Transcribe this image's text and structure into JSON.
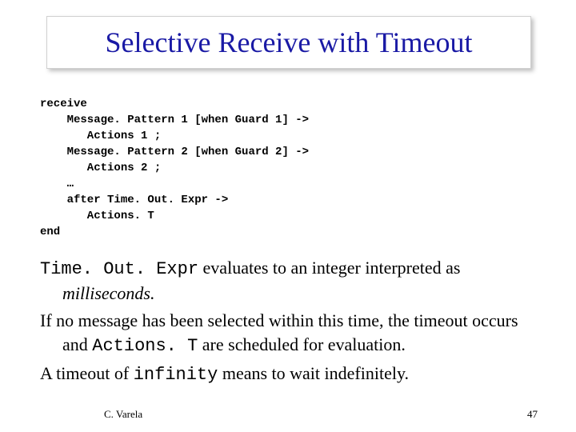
{
  "title": "Selective Receive with Timeout",
  "code": {
    "l1": "receive",
    "l2": "    Message. Pattern 1 [when Guard 1] ->",
    "l3": "       Actions 1 ;",
    "l4": "    Message. Pattern 2 [when Guard 2] ->",
    "l5": "       Actions 2 ;",
    "l6": "    …",
    "l7": "    after Time. Out. Expr ->",
    "l8": "       Actions. T",
    "l9": "end"
  },
  "body": {
    "p1a": "Time. Out. Expr",
    "p1b": " evaluates to an integer interpreted as ",
    "p1c": "milliseconds.",
    "p2a": "If no message has been selected within this time, the timeout occurs and ",
    "p2b": "Actions. T",
    "p2c": " are scheduled for evaluation.",
    "p3a": "A timeout of ",
    "p3b": "infinity",
    "p3c": " means to wait indefinitely."
  },
  "footer": {
    "left": "C. Varela",
    "right": "47"
  }
}
